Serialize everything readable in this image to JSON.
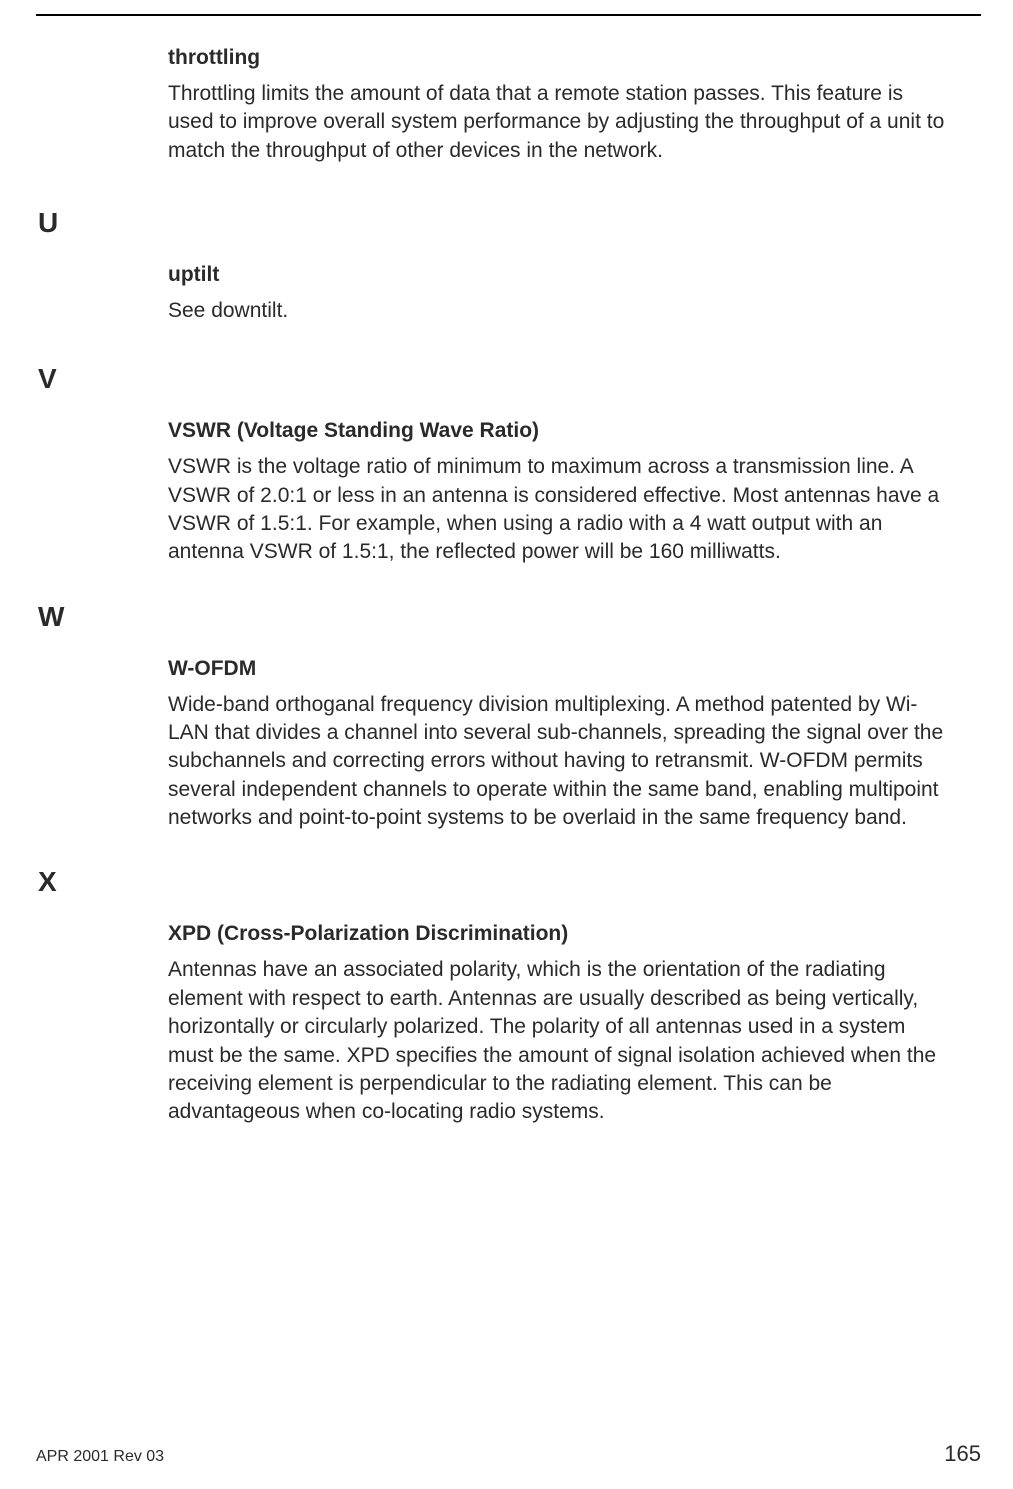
{
  "entries": {
    "throttling": {
      "term": "throttling",
      "def": "Throttling limits the amount of data that a remote station passes. This feature is used to improve overall system performance by adjusting the throughput of a unit to match the throughput of other devices in the network."
    },
    "uptilt": {
      "term": "uptilt",
      "def": "See downtilt."
    },
    "vswr": {
      "term": "VSWR (Voltage Standing Wave Ratio)",
      "def": "VSWR is the voltage ratio of minimum to maximum across a transmission line. A VSWR of 2.0:1 or less in an antenna is considered effective. Most antennas have a VSWR of 1.5:1. For example, when using a radio with a 4 watt output with an antenna VSWR of 1.5:1, the reflected power will be 160 milliwatts."
    },
    "wofdm": {
      "term": "W-OFDM",
      "def": "Wide-band orthoganal frequency division multiplexing. A method patented by Wi-LAN that divides a channel into several sub-channels, spreading the signal over the subchannels and correcting errors without having to retransmit. W-OFDM permits several independent channels to operate within the same band, enabling multipoint networks and point-to-point systems to be overlaid in the same frequency band."
    },
    "xpd": {
      "term": "XPD (Cross-Polarization Discrimination)",
      "def": "Antennas have an associated polarity, which is the orientation of the radiating element with respect to earth. Antennas are usually described as being vertically, horizontally or circularly polarized. The polarity of all antennas used in a system must be the same. XPD specifies the amount of signal isolation achieved when the receiving element is perpendicular to the radiating element. This can be advantageous when co-locating radio systems."
    }
  },
  "letters": {
    "u": "U",
    "v": "V",
    "w": "W",
    "x": "X"
  },
  "footer": {
    "left": "APR 2001 Rev 03",
    "right": "165"
  }
}
